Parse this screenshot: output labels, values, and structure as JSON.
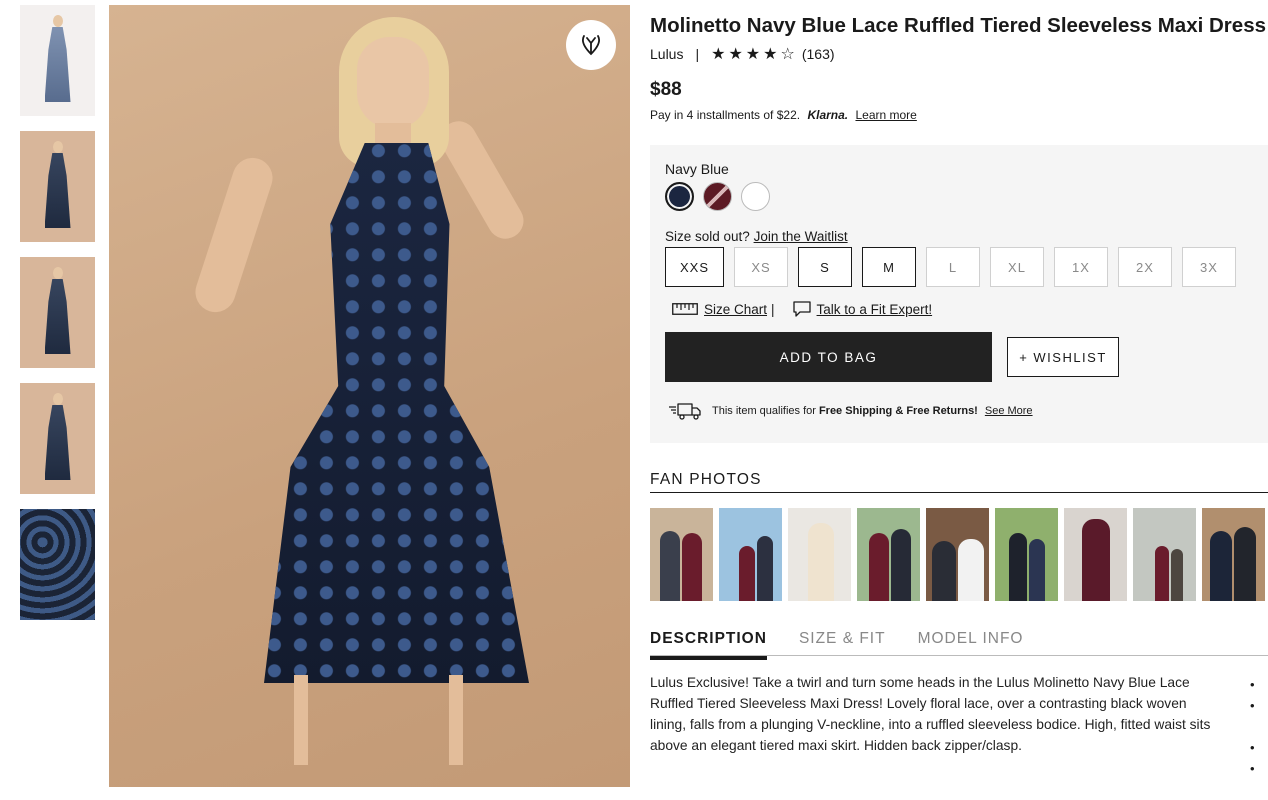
{
  "product": {
    "title": "Molinetto Navy Blue Lace Ruffled Tiered Sleeveless Maxi Dress",
    "brand": "Lulus",
    "separator": "|",
    "rating": 4.5,
    "stars": "★★★★☆",
    "review_count": "(163)",
    "price": "$88",
    "installments_text": "Pay in 4 installments of $22.",
    "klarna": "Klarna.",
    "learn_more": "Learn more"
  },
  "buybox": {
    "color_label": "Navy Blue",
    "swatches": [
      {
        "name": "Navy Blue",
        "color": "#1b2640",
        "selected": true
      },
      {
        "name": "Burgundy",
        "color": "#5c1a24",
        "selected": false
      },
      {
        "name": "White",
        "color": "#ffffff",
        "selected": false
      }
    ],
    "size_sold_out": "Size sold out?",
    "join_waitlist": "Join the Waitlist",
    "sizes": [
      {
        "label": "XXS",
        "available": true
      },
      {
        "label": "XS",
        "available": false
      },
      {
        "label": "S",
        "available": true
      },
      {
        "label": "M",
        "available": true
      },
      {
        "label": "L",
        "available": false
      },
      {
        "label": "XL",
        "available": false
      },
      {
        "label": "1X",
        "available": false
      },
      {
        "label": "2X",
        "available": false
      },
      {
        "label": "3X",
        "available": false
      }
    ],
    "size_chart": "Size Chart",
    "size_chart_sep": "|",
    "fit_expert": "Talk to a Fit Expert!",
    "add_to_bag": "ADD TO BAG",
    "wishlist": "+ WISHLIST",
    "shipping_prefix": "This item qualifies for",
    "shipping_bold": "Free Shipping & Free Returns!",
    "see_more": "See More"
  },
  "fan_photos": {
    "title": "FAN PHOTOS",
    "count": 9
  },
  "tabs": [
    {
      "label": "DESCRIPTION",
      "active": true
    },
    {
      "label": "SIZE & FIT",
      "active": false
    },
    {
      "label": "MODEL INFO",
      "active": false
    }
  ],
  "description": "Lulus Exclusive! Take a twirl and turn some heads in the Lulus Molinetto Navy Blue Lace Ruffled Tiered Sleeveless Maxi Dress! Lovely floral lace, over a contrasting black woven lining, falls from a plunging V-neckline, into a ruffled sleeveless bodice. High, fitted waist sits above an elegant tiered maxi skirt. Hidden back zipper/clasp.",
  "icons": {
    "favorite": "heart-icon",
    "size_chart": "ruler-icon",
    "fit_expert": "chat-bubble-icon",
    "shipping": "delivery-truck-icon"
  }
}
